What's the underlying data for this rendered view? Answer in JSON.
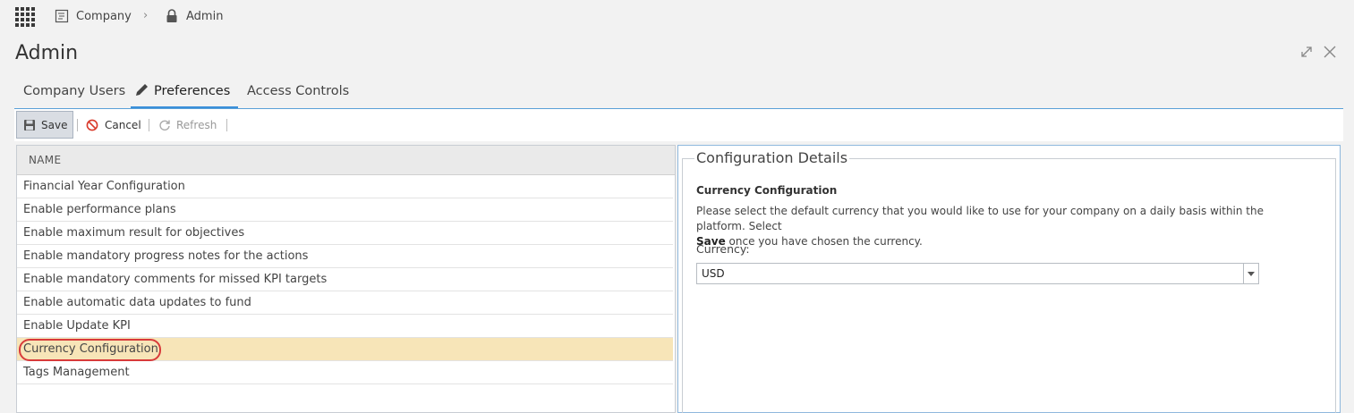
{
  "breadcrumb": {
    "items": [
      {
        "label": "Company",
        "icon": "document-icon"
      },
      {
        "label": "Admin",
        "icon": "lock-icon"
      }
    ]
  },
  "page": {
    "title": "Admin"
  },
  "tabs": [
    {
      "label": "Company Users",
      "active": false
    },
    {
      "label": "Preferences",
      "active": true,
      "icon": "pencil-icon"
    },
    {
      "label": "Access Controls",
      "active": false
    }
  ],
  "toolbar": {
    "save_label": "Save",
    "cancel_label": "Cancel",
    "refresh_label": "Refresh"
  },
  "grid": {
    "header": "NAME",
    "rows": [
      "Financial Year Configuration",
      "Enable performance plans",
      "Enable maximum result for objectives",
      "Enable mandatory progress notes for the actions",
      "Enable mandatory comments for missed KPI targets",
      "Enable automatic data updates to fund",
      "Enable Update KPI",
      "Currency Configuration",
      "Tags Management"
    ],
    "selected_index": 7
  },
  "details": {
    "legend": "Configuration Details",
    "section_title": "Currency Configuration",
    "description_part1": "Please select the default currency that you would like to use for your company on a daily basis within the platform.  Select",
    "description_bold": "Save",
    "description_part2": " once you have chosen the currency.",
    "currency_label": "Currency:",
    "currency_value": "USD"
  },
  "colors": {
    "accent": "#3a8fd9",
    "selected_row": "#f7e5b8",
    "highlight_circle": "#d83a3a"
  }
}
